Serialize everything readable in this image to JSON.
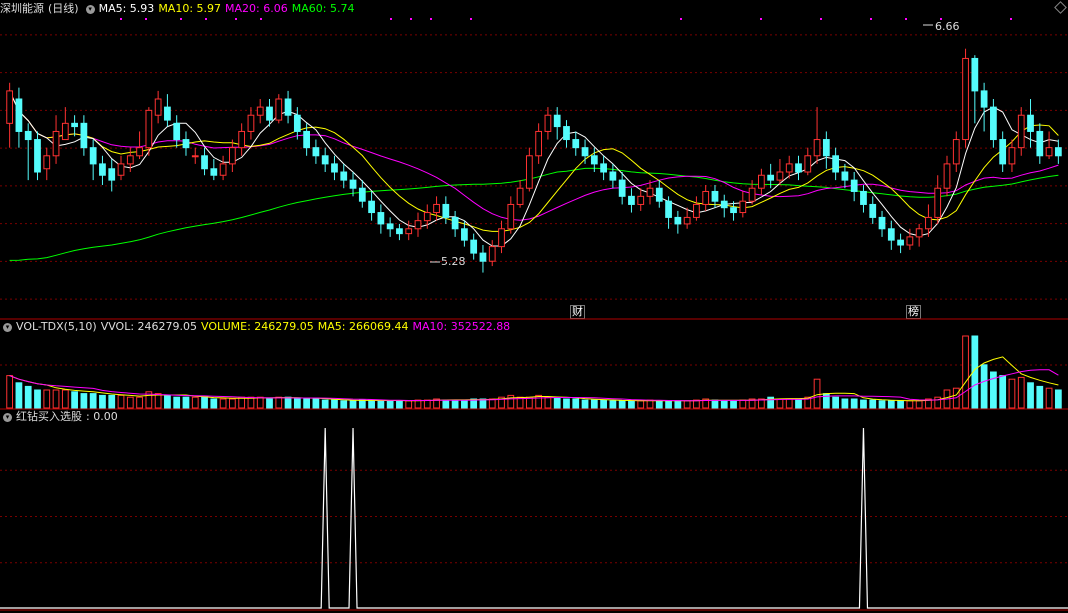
{
  "chart_data": {
    "type": "candlestick",
    "panels": {
      "price": {
        "stock_name": "深圳能源",
        "period": "(日线)",
        "indicators": [
          {
            "label": "MA5: 5.93",
            "color": "#ffffff"
          },
          {
            "label": "MA10: 5.97",
            "color": "#ffff00"
          },
          {
            "label": "MA20: 6.06",
            "color": "#ff00ff"
          },
          {
            "label": "MA60: 5.74",
            "color": "#00ff00"
          }
        ],
        "high_label": "6.66",
        "low_label": "5.28",
        "ylim": [
          5.0,
          6.8
        ],
        "markers": [
          "财",
          "榜"
        ]
      },
      "volume": {
        "name": "VOL-TDX(5,10)",
        "indicators": [
          {
            "label": "VVOL: 246279.05",
            "color": "#dddddd"
          },
          {
            "label": "VOLUME: 246279.05",
            "color": "#ffff00"
          },
          {
            "label": "MA5: 266069.44",
            "color": "#ffff00"
          },
          {
            "label": "MA10: 352522.88",
            "color": "#ff00ff"
          }
        ]
      },
      "signal": {
        "name": "红钻买入选股",
        "value_label": ": 0.00"
      }
    },
    "colors": {
      "up": "#ff3232",
      "down": "#54fcfc",
      "grid": "#7a0000",
      "ma5": "#ffffff",
      "ma10": "#ffff00",
      "ma20": "#ff00ff",
      "ma60": "#00ff00",
      "signal": "#ffffff"
    },
    "candles": [
      [
        6.2,
        6.4,
        6.45,
        6.05
      ],
      [
        6.35,
        6.15,
        6.42,
        6.05
      ],
      [
        6.15,
        6.1,
        6.2,
        5.85
      ],
      [
        6.1,
        5.9,
        6.15,
        5.85
      ],
      [
        5.92,
        6.0,
        6.05,
        5.85
      ],
      [
        6.0,
        6.15,
        6.25,
        5.95
      ],
      [
        6.1,
        6.2,
        6.3,
        6.1
      ],
      [
        6.2,
        6.18,
        6.25,
        6.12
      ],
      [
        6.2,
        6.05,
        6.25,
        6.0
      ],
      [
        6.05,
        5.95,
        6.1,
        5.85
      ],
      [
        5.95,
        5.88,
        6.0,
        5.82
      ],
      [
        5.92,
        5.85,
        5.98,
        5.78
      ],
      [
        5.88,
        5.95,
        6.0,
        5.85
      ],
      [
        5.95,
        6.0,
        6.05,
        5.9
      ],
      [
        6.0,
        6.05,
        6.15,
        5.98
      ],
      [
        6.05,
        6.28,
        6.3,
        6.0
      ],
      [
        6.25,
        6.35,
        6.4,
        6.2
      ],
      [
        6.3,
        6.22,
        6.38,
        6.18
      ],
      [
        6.2,
        6.1,
        6.25,
        6.05
      ],
      [
        6.1,
        6.05,
        6.15,
        6.0
      ],
      [
        6.0,
        6.0,
        6.05,
        5.95
      ],
      [
        6.0,
        5.92,
        6.05,
        5.88
      ],
      [
        5.92,
        5.88,
        5.98,
        5.85
      ],
      [
        5.88,
        5.95,
        6.0,
        5.85
      ],
      [
        5.95,
        6.05,
        6.1,
        5.9
      ],
      [
        6.05,
        6.15,
        6.2,
        6.0
      ],
      [
        6.15,
        6.25,
        6.3,
        6.1
      ],
      [
        6.25,
        6.3,
        6.35,
        6.2
      ],
      [
        6.3,
        6.22,
        6.35,
        6.18
      ],
      [
        6.22,
        6.35,
        6.38,
        6.2
      ],
      [
        6.35,
        6.25,
        6.4,
        6.2
      ],
      [
        6.25,
        6.15,
        6.3,
        6.1
      ],
      [
        6.15,
        6.05,
        6.2,
        6.0
      ],
      [
        6.05,
        6.0,
        6.1,
        5.95
      ],
      [
        6.0,
        5.95,
        6.05,
        5.9
      ],
      [
        5.95,
        5.9,
        6.0,
        5.85
      ],
      [
        5.9,
        5.85,
        5.95,
        5.8
      ],
      [
        5.85,
        5.8,
        5.9,
        5.75
      ],
      [
        5.8,
        5.72,
        5.85,
        5.68
      ],
      [
        5.72,
        5.65,
        5.78,
        5.6
      ],
      [
        5.65,
        5.58,
        5.7,
        5.52
      ],
      [
        5.58,
        5.55,
        5.62,
        5.5
      ],
      [
        5.55,
        5.52,
        5.58,
        5.48
      ],
      [
        5.52,
        5.55,
        5.6,
        5.48
      ],
      [
        5.55,
        5.6,
        5.65,
        5.5
      ],
      [
        5.6,
        5.65,
        5.7,
        5.55
      ],
      [
        5.65,
        5.7,
        5.75,
        5.6
      ],
      [
        5.7,
        5.62,
        5.75,
        5.58
      ],
      [
        5.62,
        5.55,
        5.66,
        5.5
      ],
      [
        5.55,
        5.48,
        5.6,
        5.44
      ],
      [
        5.48,
        5.4,
        5.52,
        5.36
      ],
      [
        5.4,
        5.35,
        5.45,
        5.28
      ],
      [
        5.35,
        5.44,
        5.48,
        5.32
      ],
      [
        5.44,
        5.55,
        5.6,
        5.4
      ],
      [
        5.55,
        5.7,
        5.75,
        5.52
      ],
      [
        5.7,
        5.8,
        5.85,
        5.68
      ],
      [
        5.8,
        6.0,
        6.05,
        5.78
      ],
      [
        6.0,
        6.15,
        6.2,
        5.95
      ],
      [
        6.15,
        6.25,
        6.3,
        6.1
      ],
      [
        6.25,
        6.18,
        6.3,
        6.1
      ],
      [
        6.18,
        6.1,
        6.22,
        6.05
      ],
      [
        6.1,
        6.05,
        6.15,
        6.0
      ],
      [
        6.05,
        6.0,
        6.1,
        5.95
      ],
      [
        6.0,
        5.95,
        6.05,
        5.9
      ],
      [
        5.95,
        5.9,
        6.0,
        5.85
      ],
      [
        5.9,
        5.85,
        5.95,
        5.8
      ],
      [
        5.85,
        5.75,
        5.9,
        5.7
      ],
      [
        5.75,
        5.7,
        5.8,
        5.65
      ],
      [
        5.7,
        5.75,
        5.8,
        5.66
      ],
      [
        5.75,
        5.8,
        5.85,
        5.7
      ],
      [
        5.8,
        5.72,
        5.85,
        5.68
      ],
      [
        5.72,
        5.62,
        5.75,
        5.55
      ],
      [
        5.62,
        5.58,
        5.66,
        5.52
      ],
      [
        5.58,
        5.62,
        5.68,
        5.55
      ],
      [
        5.62,
        5.7,
        5.75,
        5.6
      ],
      [
        5.7,
        5.78,
        5.82,
        5.66
      ],
      [
        5.78,
        5.72,
        5.82,
        5.68
      ],
      [
        5.72,
        5.68,
        5.76,
        5.62
      ],
      [
        5.68,
        5.65,
        5.72,
        5.6
      ],
      [
        5.65,
        5.72,
        5.78,
        5.62
      ],
      [
        5.72,
        5.8,
        5.85,
        5.7
      ],
      [
        5.8,
        5.88,
        5.92,
        5.76
      ],
      [
        5.88,
        5.85,
        5.95,
        5.8
      ],
      [
        5.85,
        5.9,
        5.98,
        5.82
      ],
      [
        5.9,
        5.95,
        6.0,
        5.86
      ],
      [
        5.95,
        5.9,
        6.0,
        5.85
      ],
      [
        5.9,
        6.0,
        6.05,
        5.88
      ],
      [
        6.0,
        6.1,
        6.3,
        5.95
      ],
      [
        6.1,
        6.0,
        6.15,
        5.92
      ],
      [
        6.0,
        5.9,
        6.05,
        5.85
      ],
      [
        5.9,
        5.85,
        5.95,
        5.8
      ],
      [
        5.85,
        5.78,
        5.9,
        5.72
      ],
      [
        5.78,
        5.7,
        5.82,
        5.65
      ],
      [
        5.7,
        5.62,
        5.75,
        5.58
      ],
      [
        5.62,
        5.55,
        5.66,
        5.5
      ],
      [
        5.55,
        5.48,
        5.6,
        5.42
      ],
      [
        5.48,
        5.45,
        5.52,
        5.4
      ],
      [
        5.45,
        5.5,
        5.55,
        5.42
      ],
      [
        5.5,
        5.55,
        5.58,
        5.44
      ],
      [
        5.55,
        5.62,
        5.7,
        5.5
      ],
      [
        5.62,
        5.8,
        5.88,
        5.58
      ],
      [
        5.8,
        5.95,
        6.0,
        5.75
      ],
      [
        5.95,
        6.1,
        6.15,
        5.9
      ],
      [
        6.1,
        6.6,
        6.66,
        6.05
      ],
      [
        6.6,
        6.4,
        6.62,
        6.2
      ],
      [
        6.4,
        6.3,
        6.45,
        6.15
      ],
      [
        6.3,
        6.1,
        6.35,
        6.05
      ],
      [
        6.1,
        5.95,
        6.15,
        5.9
      ],
      [
        5.95,
        6.05,
        6.1,
        5.9
      ],
      [
        6.05,
        6.25,
        6.3,
        6.0
      ],
      [
        6.25,
        6.15,
        6.35,
        6.05
      ],
      [
        6.15,
        6.0,
        6.2,
        5.95
      ],
      [
        6.0,
        6.05,
        6.15,
        5.98
      ],
      [
        6.05,
        6.0,
        6.1,
        5.95
      ]
    ],
    "volumes": [
      0.9,
      0.7,
      0.6,
      0.5,
      0.5,
      0.5,
      0.5,
      0.45,
      0.4,
      0.4,
      0.35,
      0.35,
      0.35,
      0.3,
      0.3,
      0.45,
      0.4,
      0.35,
      0.3,
      0.3,
      0.3,
      0.3,
      0.25,
      0.25,
      0.25,
      0.3,
      0.3,
      0.3,
      0.25,
      0.3,
      0.3,
      0.28,
      0.25,
      0.25,
      0.22,
      0.22,
      0.2,
      0.2,
      0.22,
      0.22,
      0.2,
      0.2,
      0.2,
      0.2,
      0.22,
      0.22,
      0.25,
      0.22,
      0.22,
      0.22,
      0.25,
      0.25,
      0.25,
      0.3,
      0.35,
      0.3,
      0.3,
      0.35,
      0.3,
      0.28,
      0.25,
      0.25,
      0.22,
      0.22,
      0.22,
      0.2,
      0.2,
      0.2,
      0.2,
      0.22,
      0.2,
      0.2,
      0.2,
      0.2,
      0.22,
      0.25,
      0.22,
      0.2,
      0.2,
      0.22,
      0.25,
      0.25,
      0.3,
      0.25,
      0.25,
      0.25,
      0.3,
      0.8,
      0.4,
      0.3,
      0.25,
      0.25,
      0.22,
      0.22,
      0.2,
      0.2,
      0.2,
      0.2,
      0.2,
      0.25,
      0.3,
      0.5,
      0.55,
      2.0,
      2.0,
      1.2,
      1.0,
      0.9,
      0.8,
      0.85,
      0.7,
      0.6,
      0.55,
      0.5
    ],
    "signal_peaks": [
      34,
      37,
      92
    ]
  }
}
